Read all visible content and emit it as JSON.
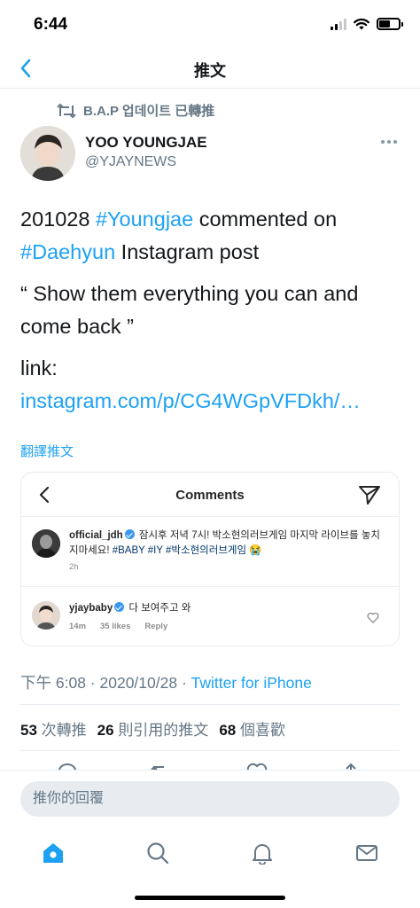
{
  "status_bar": {
    "time": "6:44"
  },
  "header": {
    "title": "推文"
  },
  "retweet_context": {
    "text": "B.A.P 업데이트 已轉推"
  },
  "author": {
    "name": "YOO YOUNGJAE",
    "handle": "@YJAYNEWS"
  },
  "tweet": {
    "p1_prefix": "201028 ",
    "p1_tag1": "#Youngjae",
    "p1_mid": " commented on ",
    "p1_tag2": "#Daehyun",
    "p1_suffix": " Instagram post",
    "p2": "“ Show them everything you can and come back ”",
    "p3_label": "link: ",
    "p3_link": "instagram.com/p/CG4WGpVFDkh/…"
  },
  "translate_label": "翻譯推文",
  "media": {
    "title": "Comments",
    "comment1": {
      "user": "official_jdh",
      "text_a": " 잠시후 저녁 7시!  박소현의러브게임  마지막 라이브를 놓치지마세요! ",
      "tags": "#BABY #IY #박소현의러브게임",
      "emoji": " 😭",
      "time": "2h"
    },
    "comment2": {
      "user": "yjaybaby",
      "text": " 다 보여주고 와",
      "time": "14m",
      "likes": "35 likes",
      "reply": "Reply"
    }
  },
  "meta": {
    "time": "下午 6:08",
    "sep1": " · ",
    "date": "2020/10/28",
    "sep2": " · ",
    "source": "Twitter for iPhone"
  },
  "stats": {
    "retweets_count": "53",
    "retweets_label": "次轉推",
    "quotes_count": "26",
    "quotes_label": "則引用的推文",
    "likes_count": "68",
    "likes_label": "個喜歡"
  },
  "reply": {
    "placeholder": "推你的回覆"
  },
  "colors": {
    "accent": "#1da1f2",
    "secondary_text": "#657786",
    "divider": "#e6ecf0"
  },
  "icons": {
    "tabs": [
      "home-icon",
      "search-icon",
      "bell-icon",
      "mail-icon"
    ],
    "actions": [
      "reply-icon",
      "retweet-icon",
      "like-icon",
      "share-icon"
    ]
  }
}
